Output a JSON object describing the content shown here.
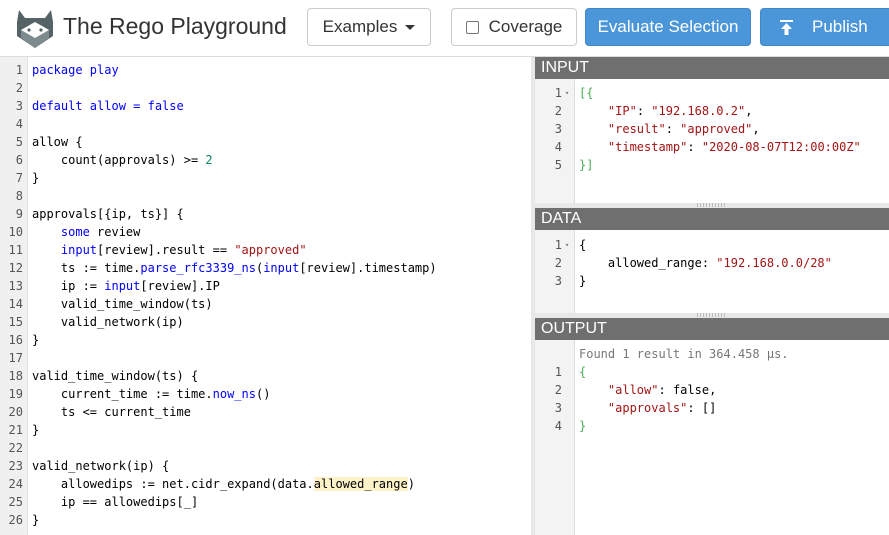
{
  "header": {
    "title": "The Rego Playground",
    "examples_label": "Examples",
    "coverage_label": "Coverage",
    "evaluate_label": "Evaluate Selection",
    "publish_label": "Publish"
  },
  "colors": {
    "accent": "#4a96d8",
    "panel_header": "#6f6f6f"
  },
  "editor": {
    "lines": [
      "1",
      "2",
      "3",
      "4",
      "5",
      "6",
      "7",
      "8",
      "9",
      "10",
      "11",
      "12",
      "13",
      "14",
      "15",
      "16",
      "17",
      "18",
      "19",
      "20",
      "21",
      "22",
      "23",
      "24",
      "25",
      "26"
    ],
    "code": {
      "l1a": "package play",
      "l3a": "default allow = ",
      "l3b": "false",
      "l5a": "allow {",
      "l6a": "    count(approvals) >= ",
      "l6b": "2",
      "l7a": "}",
      "l9a": "approvals[{ip, ts}] {",
      "l10a": "    ",
      "l10b": "some",
      "l10c": " review",
      "l11a": "    ",
      "l11b": "input",
      "l11c": "[review].result == ",
      "l11d": "\"approved\"",
      "l12a": "    ts := time.",
      "l12b": "parse_rfc3339_ns",
      "l12c": "(",
      "l12d": "input",
      "l12e": "[review].timestamp)",
      "l13a": "    ip := ",
      "l13b": "input",
      "l13c": "[review].IP",
      "l14a": "    valid_time_window(ts)",
      "l15a": "    valid_network(ip)",
      "l16a": "}",
      "l18a": "valid_time_window(ts) {",
      "l19a": "    current_time := time.",
      "l19b": "now_ns",
      "l19c": "()",
      "l20a": "    ts <= current_time",
      "l21a": "}",
      "l23a": "valid_network(ip) {",
      "l24a": "    allowedips := net.cidr_expand(data.",
      "l24b": "allowed_range",
      "l24c": ")",
      "l25a": "    ip == allowedips[_]",
      "l26a": "}"
    }
  },
  "input_panel": {
    "title": "INPUT",
    "lines": [
      "1",
      "2",
      "3",
      "4",
      "5"
    ],
    "l1": "[{",
    "l2k": "\"IP\"",
    "l2v": "\"192.168.0.2\"",
    "l3k": "\"result\"",
    "l3v": "\"approved\"",
    "l4k": "\"timestamp\"",
    "l4v": "\"2020-08-07T12:00:00Z\"",
    "l5": "}]",
    "colon": ": ",
    "comma": ","
  },
  "data_panel": {
    "title": "DATA",
    "lines": [
      "1",
      "2",
      "3"
    ],
    "l1": "{",
    "l2k": "allowed_range",
    "l2v": "\"192.168.0.0/28\"",
    "l3": "}",
    "colon": ": "
  },
  "output_panel": {
    "title": "OUTPUT",
    "status": "Found 1 result in 364.458 µs.",
    "lines": [
      "1",
      "2",
      "3",
      "4"
    ],
    "l1": "{",
    "l2k": "\"allow\"",
    "l2v": "false",
    "l3k": "\"approvals\"",
    "l3v": "[]",
    "l4": "}",
    "colon": ": ",
    "comma": ","
  }
}
